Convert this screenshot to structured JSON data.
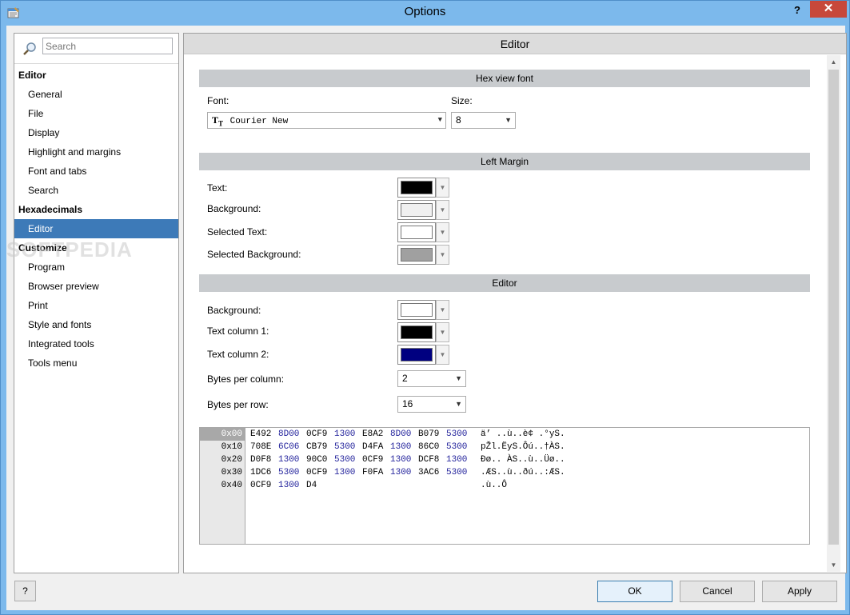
{
  "window": {
    "title": "Options",
    "help": "?",
    "close": "✕"
  },
  "search": {
    "placeholder": "Search"
  },
  "nav": {
    "editor_cat": "Editor",
    "general": "General",
    "file": "File",
    "display": "Display",
    "highlight": "Highlight and margins",
    "font_tabs": "Font and tabs",
    "search": "Search",
    "hex_cat": "Hexadecimals",
    "hex_editor": "Editor",
    "customize_cat": "Customize",
    "program": "Program",
    "browser_preview": "Browser preview",
    "print": "Print",
    "style_fonts": "Style and fonts",
    "integrated_tools": "Integrated tools",
    "tools_menu": "Tools menu"
  },
  "pane": {
    "title": "Editor"
  },
  "hex_font": {
    "section": "Hex view font",
    "font_label": "Font:",
    "font_value": "Courier New",
    "size_label": "Size:",
    "size_value": "8"
  },
  "left_margin": {
    "section": "Left Margin",
    "text_label": "Text:",
    "text_color": "#000000",
    "background_label": "Background:",
    "background_color": "#f0f0f0",
    "selected_text_label": "Selected Text:",
    "selected_text_color": "#ffffff",
    "selected_background_label": "Selected Background:",
    "selected_background_color": "#a0a0a0"
  },
  "editor": {
    "section": "Editor",
    "background_label": "Background:",
    "background_color": "#ffffff",
    "col1_label": "Text column 1:",
    "col1_color": "#000000",
    "col2_label": "Text column 2:",
    "col2_color": "#000080",
    "bytes_col_label": "Bytes per column:",
    "bytes_col_value": "2",
    "bytes_row_label": "Bytes per row:",
    "bytes_row_value": "16"
  },
  "hexview": {
    "offsets": [
      "0x00",
      "0x10",
      "0x20",
      "0x30",
      "0x40"
    ],
    "rows": [
      {
        "words": [
          "E492",
          "8D00",
          "0CF9",
          "1300",
          "E8A2",
          "8D00",
          "B079",
          "5300"
        ],
        "text": "ä’ ..ù..è¢ .°yS."
      },
      {
        "words": [
          "708E",
          "6C06",
          "CB79",
          "5300",
          "D4FA",
          "1300",
          "86C0",
          "5300"
        ],
        "text": "pŽl.ËyS.Ôú..†ÀS."
      },
      {
        "words": [
          "D0F8",
          "1300",
          "90C0",
          "5300",
          "0CF9",
          "1300",
          "DCF8",
          "1300"
        ],
        "text": "Ðø.. ÀS..ù..Üø.."
      },
      {
        "words": [
          "1DC6",
          "5300",
          "0CF9",
          "1300",
          "F0FA",
          "1300",
          "3AC6",
          "5300"
        ],
        "text": ".ÆS..ù..ðú..:ÆS."
      },
      {
        "words": [
          "0CF9",
          "1300",
          "D4"
        ],
        "text": ".ù..Ô"
      }
    ]
  },
  "buttons": {
    "help": "?",
    "ok": "OK",
    "cancel": "Cancel",
    "apply": "Apply"
  },
  "watermark": "SOFTPEDIA"
}
